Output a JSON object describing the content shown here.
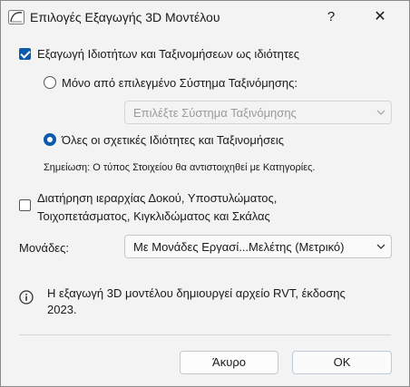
{
  "window": {
    "title": "Επιλογές Εξαγωγής 3D Μοντέλου",
    "help_label": "?",
    "close_label": "✕"
  },
  "export_properties": {
    "label": "Εξαγωγή Ιδιοτήτων και Ταξινομήσεων ως ιδιότητες",
    "checked": true
  },
  "radio_selected_system": {
    "label": "Μόνο από επιλεγμένο Σύστημα Ταξινόμησης:",
    "selected": false
  },
  "classification_dropdown": {
    "value": "Επιλέξτε Σύστημα Ταξινόμησης",
    "enabled": false
  },
  "radio_all": {
    "label": "Όλες οι σχετικές Ιδιότητες και Ταξινομήσεις",
    "selected": true
  },
  "note": "Σημείωση: Ο τύπος Στοιχείου θα αντιστοιχηθεί με Κατηγορίες.",
  "hierarchy": {
    "line1": "Διατήρηση ιεραρχίας Δοκού, Υποστυλώματος,",
    "line2": "Τοιχοπετάσματος, Κιγκλιδώματος και Σκάλας",
    "checked": false
  },
  "units": {
    "label": "Μονάδες:",
    "value": "Με Μονάδες Εργασί...Μελέτης (Μετρικό)"
  },
  "info": {
    "line1": "Η εξαγωγή 3D μοντέλου δημιουργεί αρχείο RVT, έκδοσης",
    "line2": "2023."
  },
  "buttons": {
    "cancel": "Άκυρο",
    "ok": "OK"
  },
  "colors": {
    "accent": "#0b5cad",
    "dialog_bg": "#f3f3f3"
  }
}
